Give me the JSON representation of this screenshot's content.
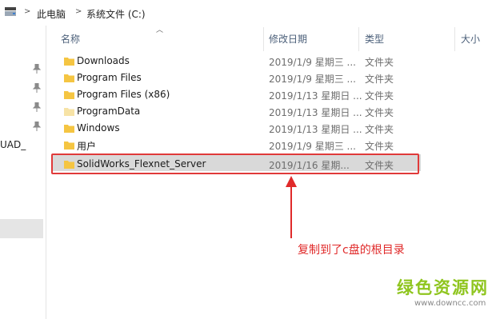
{
  "address": {
    "crumbs": [
      "此电脑",
      "系统文件 (C:)"
    ],
    "separator": ">"
  },
  "nav": {
    "truncated_text": "UAD_"
  },
  "columns": {
    "name": "名称",
    "date": "修改日期",
    "type": "类型",
    "size": "大小"
  },
  "rows": [
    {
      "name": "Downloads",
      "date": "2019/1/9 星期三 ...",
      "type": "文件夹"
    },
    {
      "name": "Program Files",
      "date": "2019/1/9 星期三 ...",
      "type": "文件夹"
    },
    {
      "name": "Program Files (x86)",
      "date": "2019/1/13 星期日 ...",
      "type": "文件夹"
    },
    {
      "name": "ProgramData",
      "date": "2019/1/13 星期日 ...",
      "type": "文件夹"
    },
    {
      "name": "Windows",
      "date": "2019/1/13 星期日 ...",
      "type": "文件夹"
    },
    {
      "name": "用户",
      "date": "2019/1/9 星期三 ...",
      "type": "文件夹"
    },
    {
      "name": "SolidWorks_Flexnet_Server",
      "date": "2019/1/16 星期...",
      "type": "文件夹"
    }
  ],
  "annotation": {
    "text": "复制到了c盘的根目录",
    "color": "#e02a2a"
  },
  "watermark": {
    "title": "绿色资源网",
    "url": "www.downcc.com"
  },
  "colors": {
    "folder": "#f5c542",
    "folder_light": "#f7e3a6",
    "selected_row": "#d9d9d9",
    "header_text": "#4c607a"
  }
}
